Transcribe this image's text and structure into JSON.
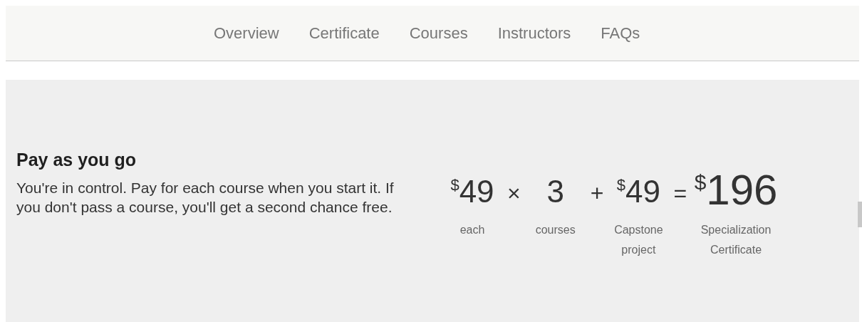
{
  "nav": {
    "items": [
      {
        "label": "Overview"
      },
      {
        "label": "Certificate"
      },
      {
        "label": "Courses"
      },
      {
        "label": "Instructors"
      },
      {
        "label": "FAQs"
      }
    ]
  },
  "pricing": {
    "title": "Pay as you go",
    "description": "You're in control. Pay for each course when you start it. If you don't pass a course, you'll get a second chance free.",
    "equation": [
      {
        "kind": "term",
        "currency": "$",
        "amount": "49",
        "caption": "each"
      },
      {
        "kind": "operator",
        "symbol": "×"
      },
      {
        "kind": "term",
        "amount": "3",
        "caption": "courses"
      },
      {
        "kind": "operator",
        "symbol": "+"
      },
      {
        "kind": "term",
        "currency": "$",
        "amount": "49",
        "caption": "Capstone project"
      },
      {
        "kind": "operator",
        "symbol": "="
      },
      {
        "kind": "total",
        "currency": "$",
        "amount": "196",
        "caption": "Specialization Certificate"
      }
    ]
  }
}
